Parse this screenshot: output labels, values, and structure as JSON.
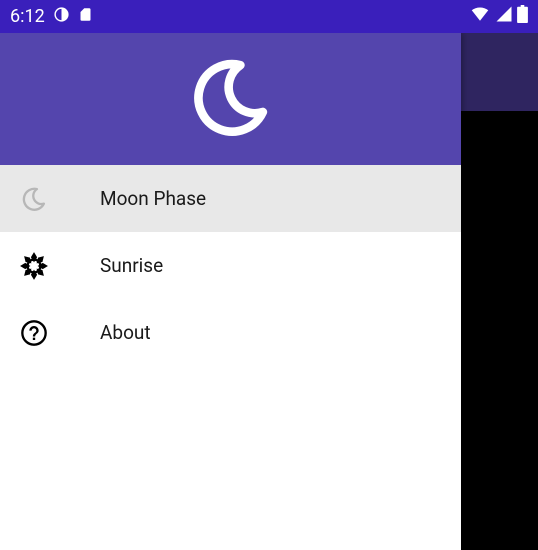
{
  "status": {
    "time": "6:12"
  },
  "drawer": {
    "items": [
      {
        "label": "Moon Phase"
      },
      {
        "label": "Sunrise"
      },
      {
        "label": "About"
      }
    ]
  },
  "colors": {
    "statusbar": "#3a1fbb",
    "secondary": "#2f2560",
    "drawerHeader": "#5445ad",
    "selected": "#e8e8e8"
  }
}
